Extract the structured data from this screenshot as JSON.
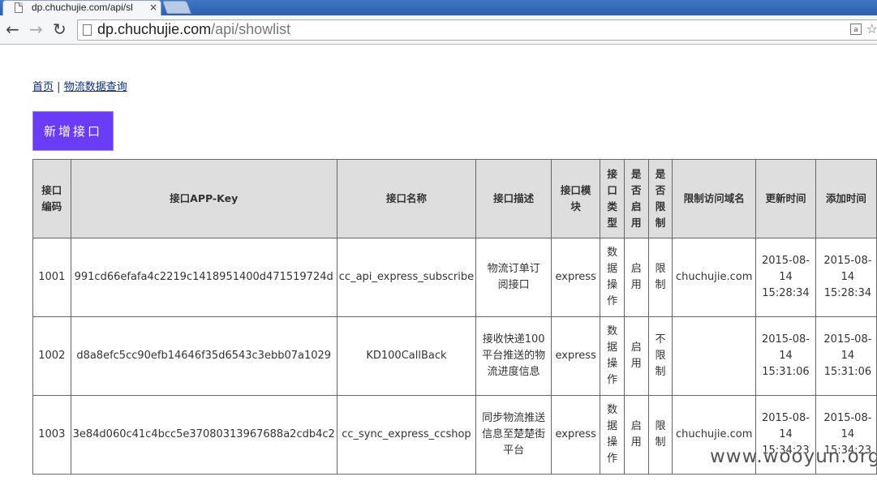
{
  "browser": {
    "tab_title": "dp.chuchujie.com/api/sl",
    "tab_close": "×",
    "url_host": "dp.chuchujie.com",
    "url_path": "/api/showlist",
    "translate_glyph": "a"
  },
  "breadcrumb": {
    "home": "首页",
    "separator": "|",
    "current": "物流数据查询"
  },
  "add_button": "新增接口",
  "table": {
    "headers": [
      "接口编码",
      "接口APP-Key",
      "接口名称",
      "接口描述",
      "接口模块",
      "接口类型",
      "是否启用",
      "是否限制",
      "限制访问域名",
      "更新时间",
      "添加时间"
    ],
    "rows": [
      [
        "1001",
        "991cd66efafa4c2219c1418951400d471519724d",
        "cc_api_express_subscribe",
        "物流订单订阅接口",
        "express",
        "数据操作",
        "启用",
        "限制",
        "chuchujie.com",
        "2015-08-14 15:28:34",
        "2015-08-14 15:28:34"
      ],
      [
        "1002",
        "d8a8efc5cc90efb14646f35d6543c3ebb07a1029",
        "KD100CallBack",
        "接收快递100平台推送的物流进度信息",
        "express",
        "数据操作",
        "启用",
        "不限制",
        "",
        "2015-08-14 15:31:06",
        "2015-08-14 15:31:06"
      ],
      [
        "1003",
        "3e84d060c41c4bcc5e37080313967688a2cdb4c2",
        "cc_sync_express_ccshop",
        "同步物流推送信息至楚楚街平台",
        "express",
        "数据操作",
        "启用",
        "限制",
        "chuchujie.com",
        "2015-08-14 15:34:23",
        "2015-08-14 15:34:23"
      ]
    ]
  },
  "watermark": "www.wooyun.org"
}
